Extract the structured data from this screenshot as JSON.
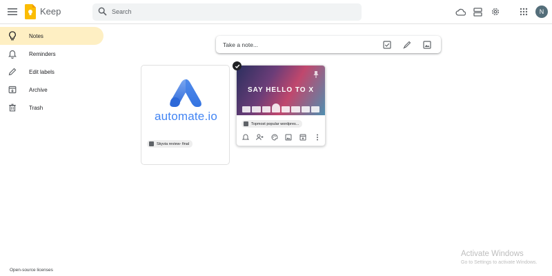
{
  "header": {
    "app_title": "Keep",
    "search_placeholder": "Search",
    "avatar_initial": "N",
    "icons": [
      "menu-icon",
      "keep-logo",
      "search-icon",
      "cloud-icon",
      "list-view-icon",
      "settings-icon",
      "apps-icon"
    ]
  },
  "sidebar": {
    "items": [
      {
        "label": "Notes",
        "icon": "lightbulb-icon",
        "active": true
      },
      {
        "label": "Reminders",
        "icon": "bell-icon",
        "active": false
      },
      {
        "label": "Edit labels",
        "icon": "pencil-icon",
        "active": false
      },
      {
        "label": "Archive",
        "icon": "archive-icon",
        "active": false
      },
      {
        "label": "Trash",
        "icon": "trash-icon",
        "active": false
      }
    ],
    "footer_link": "Open-source licenses"
  },
  "take_note": {
    "placeholder": "Take a note...",
    "icons": [
      "checkbox-icon",
      "brush-icon",
      "image-icon"
    ]
  },
  "notes": [
    {
      "image_text": "automate.io",
      "chip_label": "Skyvia review- final"
    },
    {
      "image_text": "SAY HELLO TO X",
      "chip_label": "Topmost popular wordpres...",
      "selected": true,
      "toolbar_icons": [
        "remind-icon",
        "collaborator-icon",
        "palette-icon",
        "image-icon",
        "archive-icon",
        "more-icon"
      ]
    }
  ],
  "watermark": {
    "title": "Activate Windows",
    "subtitle": "Go to Settings to activate Windows."
  },
  "colors": {
    "active_nav": "#feefc3",
    "search_bg": "#f1f3f4",
    "logo_yellow": "#fbbc04",
    "brand_blue": "#4285f4"
  }
}
